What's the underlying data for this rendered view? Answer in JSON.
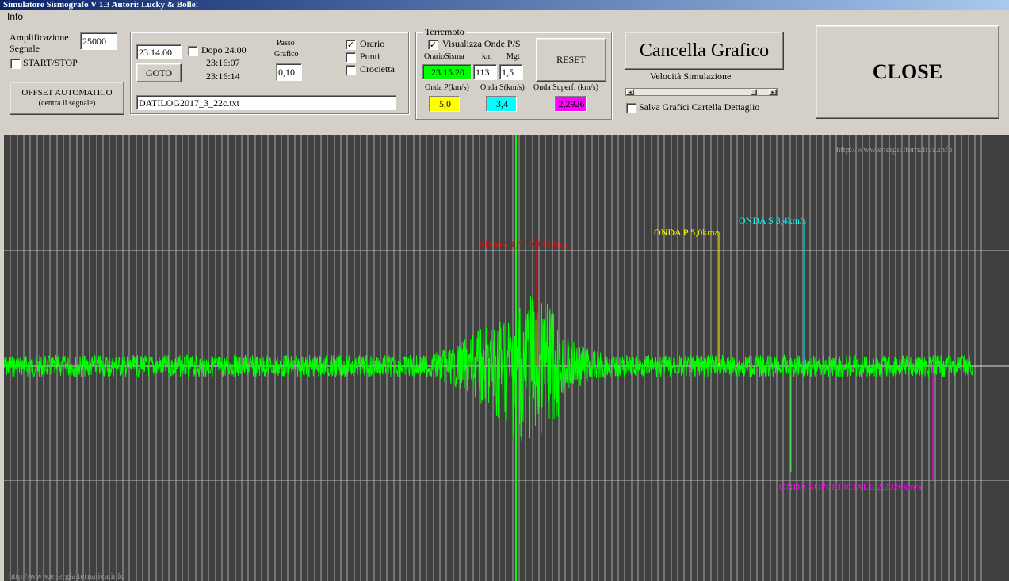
{
  "window": {
    "title": "Simulatore Sismografo V 1.3  Autori: Lucky & Bolle!"
  },
  "menu": {
    "info": "Info"
  },
  "amplification": {
    "label_line1": "Amplificazione",
    "label_line2": "Segnale",
    "value": "25000"
  },
  "start_stop": {
    "label": "START/STOP",
    "checked": false
  },
  "offset": {
    "line1": "OFFSET AUTOMATICO",
    "line2": "(centra il segnale)"
  },
  "time_panel": {
    "time_value": "23.14.00",
    "goto_label": "GOTO",
    "after_midnight_label": "Dopo 24.00",
    "time1": "23:16:07",
    "time2": "23:16:14",
    "step_label_line1": "Passo",
    "step_label_line2": "Grafico",
    "step_value": "0,10",
    "filename": "DATILOG2017_3_22c.txt",
    "options": [
      {
        "label": "Orario",
        "checked": true
      },
      {
        "label": "Punti",
        "checked": false
      },
      {
        "label": "Crocietta",
        "checked": false
      }
    ]
  },
  "earthquake": {
    "group_title": "Terremoto",
    "show_waves_label": "Visualizza Onde P/S",
    "show_waves_checked": true,
    "time_header": "OrarioSisma",
    "km_header": "km",
    "mag_header": "Mgt",
    "time_value": "23.15.20",
    "km_value": "113",
    "mag_value": "1,5",
    "reset_label": "RESET",
    "p_label": "Onda P(km/s)",
    "s_label": "Onda S(km/s)",
    "surf_label": "Onda Superf. (km/s)",
    "p_value": "5,0",
    "s_value": "3,4",
    "surf_value": "2,2926",
    "p_color": "#ffff00",
    "s_color": "#00ffff",
    "surf_color": "#ff00ff",
    "time_color": "#00ff00"
  },
  "clear_button": {
    "label": "Cancella Grafico"
  },
  "speed": {
    "label": "Velocità Simulazione",
    "level": 0.91
  },
  "save_graphs": {
    "label": "Salva Grafici Cartella Dettaglio",
    "checked": false
  },
  "close_button": {
    "label": "CLOSE"
  },
  "plot": {
    "watermark_top": "http://www.energialternativa.info",
    "watermark_bottom": "http://www.energialternativa.info",
    "signal_color": "#00ff00",
    "background_color": "#404040",
    "markers": {
      "sisma": "SISMA 1,5° A 113 Km",
      "onda_p": "ONDA P 5,0km/s",
      "onda_s": "ONDA S 3,4km/s",
      "onda_surf": "ONDA SUPERFICIALE 2,2926km/s"
    },
    "marker_colors": {
      "sisma": "#ff0000",
      "onda_p": "#ffff00",
      "onda_s": "#00ffff",
      "onda_surf": "#ff00ff"
    }
  }
}
